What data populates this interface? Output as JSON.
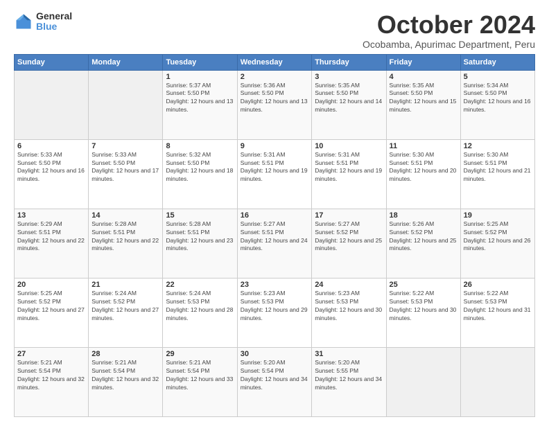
{
  "logo": {
    "general": "General",
    "blue": "Blue"
  },
  "title": "October 2024",
  "subtitle": "Ocobamba, Apurimac Department, Peru",
  "days_of_week": [
    "Sunday",
    "Monday",
    "Tuesday",
    "Wednesday",
    "Thursday",
    "Friday",
    "Saturday"
  ],
  "weeks": [
    [
      {
        "day": "",
        "sunrise": "",
        "sunset": "",
        "daylight": ""
      },
      {
        "day": "",
        "sunrise": "",
        "sunset": "",
        "daylight": ""
      },
      {
        "day": "1",
        "sunrise": "Sunrise: 5:37 AM",
        "sunset": "Sunset: 5:50 PM",
        "daylight": "Daylight: 12 hours and 13 minutes."
      },
      {
        "day": "2",
        "sunrise": "Sunrise: 5:36 AM",
        "sunset": "Sunset: 5:50 PM",
        "daylight": "Daylight: 12 hours and 13 minutes."
      },
      {
        "day": "3",
        "sunrise": "Sunrise: 5:35 AM",
        "sunset": "Sunset: 5:50 PM",
        "daylight": "Daylight: 12 hours and 14 minutes."
      },
      {
        "day": "4",
        "sunrise": "Sunrise: 5:35 AM",
        "sunset": "Sunset: 5:50 PM",
        "daylight": "Daylight: 12 hours and 15 minutes."
      },
      {
        "day": "5",
        "sunrise": "Sunrise: 5:34 AM",
        "sunset": "Sunset: 5:50 PM",
        "daylight": "Daylight: 12 hours and 16 minutes."
      }
    ],
    [
      {
        "day": "6",
        "sunrise": "Sunrise: 5:33 AM",
        "sunset": "Sunset: 5:50 PM",
        "daylight": "Daylight: 12 hours and 16 minutes."
      },
      {
        "day": "7",
        "sunrise": "Sunrise: 5:33 AM",
        "sunset": "Sunset: 5:50 PM",
        "daylight": "Daylight: 12 hours and 17 minutes."
      },
      {
        "day": "8",
        "sunrise": "Sunrise: 5:32 AM",
        "sunset": "Sunset: 5:50 PM",
        "daylight": "Daylight: 12 hours and 18 minutes."
      },
      {
        "day": "9",
        "sunrise": "Sunrise: 5:31 AM",
        "sunset": "Sunset: 5:51 PM",
        "daylight": "Daylight: 12 hours and 19 minutes."
      },
      {
        "day": "10",
        "sunrise": "Sunrise: 5:31 AM",
        "sunset": "Sunset: 5:51 PM",
        "daylight": "Daylight: 12 hours and 19 minutes."
      },
      {
        "day": "11",
        "sunrise": "Sunrise: 5:30 AM",
        "sunset": "Sunset: 5:51 PM",
        "daylight": "Daylight: 12 hours and 20 minutes."
      },
      {
        "day": "12",
        "sunrise": "Sunrise: 5:30 AM",
        "sunset": "Sunset: 5:51 PM",
        "daylight": "Daylight: 12 hours and 21 minutes."
      }
    ],
    [
      {
        "day": "13",
        "sunrise": "Sunrise: 5:29 AM",
        "sunset": "Sunset: 5:51 PM",
        "daylight": "Daylight: 12 hours and 22 minutes."
      },
      {
        "day": "14",
        "sunrise": "Sunrise: 5:28 AM",
        "sunset": "Sunset: 5:51 PM",
        "daylight": "Daylight: 12 hours and 22 minutes."
      },
      {
        "day": "15",
        "sunrise": "Sunrise: 5:28 AM",
        "sunset": "Sunset: 5:51 PM",
        "daylight": "Daylight: 12 hours and 23 minutes."
      },
      {
        "day": "16",
        "sunrise": "Sunrise: 5:27 AM",
        "sunset": "Sunset: 5:51 PM",
        "daylight": "Daylight: 12 hours and 24 minutes."
      },
      {
        "day": "17",
        "sunrise": "Sunrise: 5:27 AM",
        "sunset": "Sunset: 5:52 PM",
        "daylight": "Daylight: 12 hours and 25 minutes."
      },
      {
        "day": "18",
        "sunrise": "Sunrise: 5:26 AM",
        "sunset": "Sunset: 5:52 PM",
        "daylight": "Daylight: 12 hours and 25 minutes."
      },
      {
        "day": "19",
        "sunrise": "Sunrise: 5:25 AM",
        "sunset": "Sunset: 5:52 PM",
        "daylight": "Daylight: 12 hours and 26 minutes."
      }
    ],
    [
      {
        "day": "20",
        "sunrise": "Sunrise: 5:25 AM",
        "sunset": "Sunset: 5:52 PM",
        "daylight": "Daylight: 12 hours and 27 minutes."
      },
      {
        "day": "21",
        "sunrise": "Sunrise: 5:24 AM",
        "sunset": "Sunset: 5:52 PM",
        "daylight": "Daylight: 12 hours and 27 minutes."
      },
      {
        "day": "22",
        "sunrise": "Sunrise: 5:24 AM",
        "sunset": "Sunset: 5:53 PM",
        "daylight": "Daylight: 12 hours and 28 minutes."
      },
      {
        "day": "23",
        "sunrise": "Sunrise: 5:23 AM",
        "sunset": "Sunset: 5:53 PM",
        "daylight": "Daylight: 12 hours and 29 minutes."
      },
      {
        "day": "24",
        "sunrise": "Sunrise: 5:23 AM",
        "sunset": "Sunset: 5:53 PM",
        "daylight": "Daylight: 12 hours and 30 minutes."
      },
      {
        "day": "25",
        "sunrise": "Sunrise: 5:22 AM",
        "sunset": "Sunset: 5:53 PM",
        "daylight": "Daylight: 12 hours and 30 minutes."
      },
      {
        "day": "26",
        "sunrise": "Sunrise: 5:22 AM",
        "sunset": "Sunset: 5:53 PM",
        "daylight": "Daylight: 12 hours and 31 minutes."
      }
    ],
    [
      {
        "day": "27",
        "sunrise": "Sunrise: 5:21 AM",
        "sunset": "Sunset: 5:54 PM",
        "daylight": "Daylight: 12 hours and 32 minutes."
      },
      {
        "day": "28",
        "sunrise": "Sunrise: 5:21 AM",
        "sunset": "Sunset: 5:54 PM",
        "daylight": "Daylight: 12 hours and 32 minutes."
      },
      {
        "day": "29",
        "sunrise": "Sunrise: 5:21 AM",
        "sunset": "Sunset: 5:54 PM",
        "daylight": "Daylight: 12 hours and 33 minutes."
      },
      {
        "day": "30",
        "sunrise": "Sunrise: 5:20 AM",
        "sunset": "Sunset: 5:54 PM",
        "daylight": "Daylight: 12 hours and 34 minutes."
      },
      {
        "day": "31",
        "sunrise": "Sunrise: 5:20 AM",
        "sunset": "Sunset: 5:55 PM",
        "daylight": "Daylight: 12 hours and 34 minutes."
      },
      {
        "day": "",
        "sunrise": "",
        "sunset": "",
        "daylight": ""
      },
      {
        "day": "",
        "sunrise": "",
        "sunset": "",
        "daylight": ""
      }
    ]
  ]
}
